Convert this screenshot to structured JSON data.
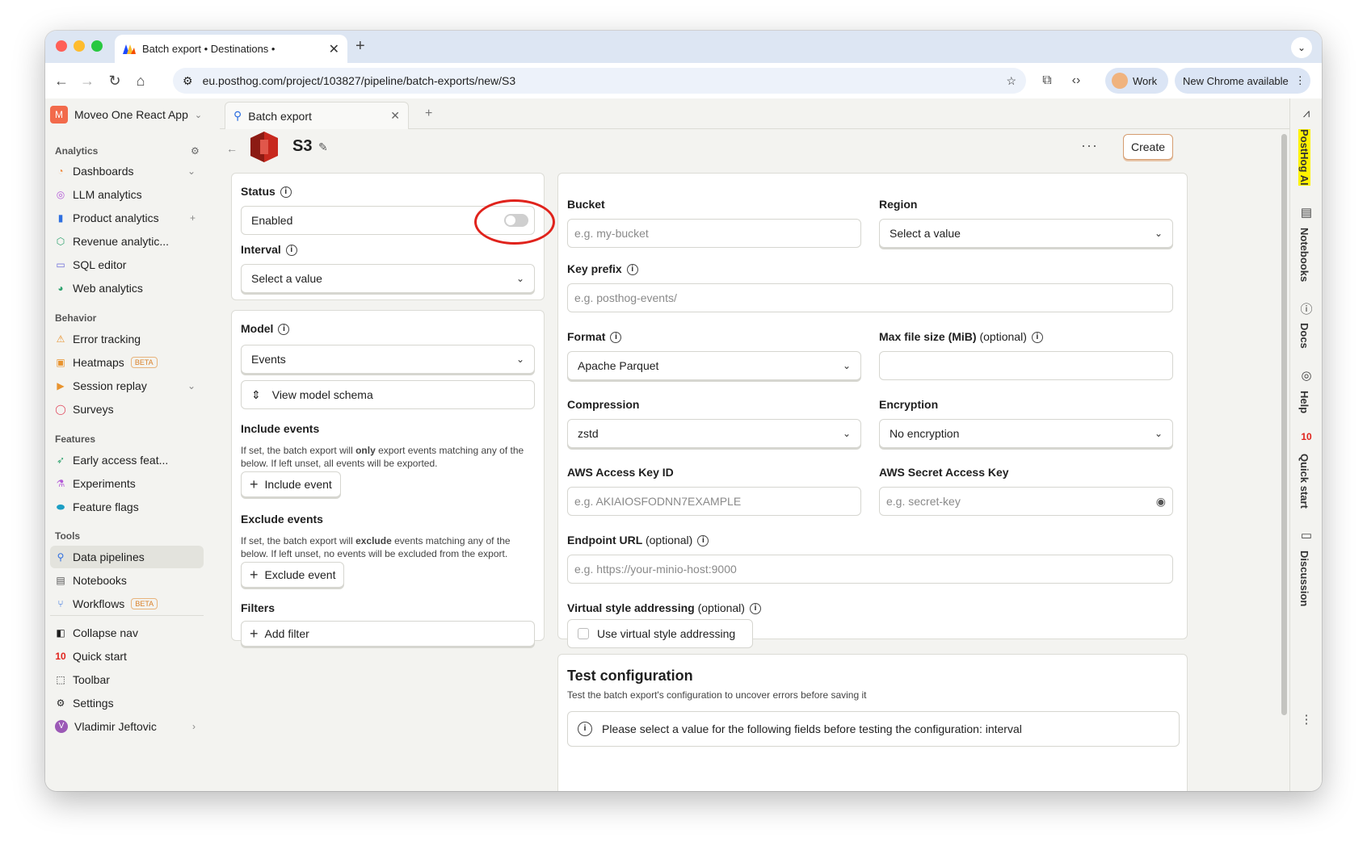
{
  "browser": {
    "tab_title": "Batch export • Destinations •",
    "url": "eu.posthog.com/project/103827/pipeline/batch-exports/new/S3",
    "profile": "Work",
    "update": "New Chrome available"
  },
  "sidebar": {
    "project": "Moveo One React App",
    "project_initial": "M",
    "sections": [
      {
        "title": "Analytics",
        "items": [
          "Dashboards",
          "LLM analytics",
          "Product analytics",
          "Revenue analytic...",
          "SQL editor",
          "Web analytics"
        ]
      },
      {
        "title": "Behavior",
        "items": [
          "Error tracking",
          "Heatmaps",
          "Session replay",
          "Surveys"
        ]
      },
      {
        "title": "Features",
        "items": [
          "Early access feat...",
          "Experiments",
          "Feature flags"
        ]
      },
      {
        "title": "Tools",
        "items": [
          "Data pipelines",
          "Notebooks",
          "Workflows"
        ]
      }
    ],
    "beta_label": "BETA",
    "bottom": [
      "Collapse nav",
      "Quick start",
      "Toolbar",
      "Settings"
    ],
    "user": "Vladimir Jeftovic",
    "user_initial": "V"
  },
  "page_tab": "Batch export",
  "header": {
    "title": "S3",
    "create": "Create"
  },
  "left": {
    "status_label": "Status",
    "enabled_label": "Enabled",
    "enabled": false,
    "interval_label": "Interval",
    "interval_value": "Select a value",
    "model_label": "Model",
    "model_value": "Events",
    "view_schema": "View model schema",
    "include_title": "Include events",
    "include_help_1": "If set, the batch export will ",
    "include_help_bold": "only",
    "include_help_2": " export events matching any of the below. If left unset, all events will be exported.",
    "include_btn": "Include event",
    "exclude_title": "Exclude events",
    "exclude_help_1": "If set, the batch export will ",
    "exclude_help_bold": "exclude",
    "exclude_help_2": " events matching any of the below. If left unset, no events will be excluded from the export.",
    "exclude_btn": "Exclude event",
    "filters_title": "Filters",
    "add_filter": "Add filter"
  },
  "right": {
    "bucket_label": "Bucket",
    "bucket_placeholder": "e.g. my-bucket",
    "region_label": "Region",
    "region_value": "Select a value",
    "key_prefix_label": "Key prefix",
    "key_prefix_placeholder": "e.g. posthog-events/",
    "format_label": "Format",
    "format_value": "Apache Parquet",
    "max_size_label": "Max file size (MiB)",
    "optional": "(optional)",
    "compression_label": "Compression",
    "compression_value": "zstd",
    "encryption_label": "Encryption",
    "encryption_value": "No encryption",
    "access_key_label": "AWS Access Key ID",
    "access_key_placeholder": "e.g. AKIAIOSFODNN7EXAMPLE",
    "secret_label": "AWS Secret Access Key",
    "secret_placeholder": "e.g. secret-key",
    "endpoint_label": "Endpoint URL",
    "endpoint_placeholder": "e.g. https://your-minio-host:9000",
    "virtual_label": "Virtual style addressing",
    "virtual_checkbox": "Use virtual style addressing"
  },
  "test": {
    "title": "Test configuration",
    "subtitle": "Test the batch export's configuration to uncover errors before saving it",
    "notice": "Please select a value for the following fields before testing the configuration: interval"
  },
  "rightbar": [
    "PostHog AI",
    "Notebooks",
    "Docs",
    "Help",
    "Quick start",
    "Discussion"
  ],
  "quickstart_badge": "10",
  "colors": {
    "accent": "#f54e00",
    "highlight": "#fff200",
    "annotation": "#e0231c"
  }
}
